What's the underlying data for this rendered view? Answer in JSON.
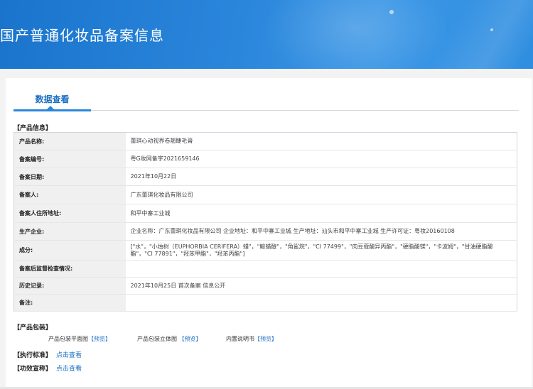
{
  "header": {
    "title": "国产普通化妆品备案信息"
  },
  "tabs": [
    {
      "label": "数据查看",
      "active": true
    }
  ],
  "product_info": {
    "section_title": "【产品信息】",
    "rows": [
      {
        "key": "产品名称:",
        "value": "蕾琪心动视界卷翘睫毛膏"
      },
      {
        "key": "备案编号:",
        "value": "粤G妆网备字2021659146"
      },
      {
        "key": "备案日期:",
        "value": "2021年10月22日"
      },
      {
        "key": "备案人:",
        "value": "广东蕾琪化妆品有限公司"
      },
      {
        "key": "备案人住所地址:",
        "value": "和平中寨工业城"
      },
      {
        "key": "生产企业:",
        "value": "企业名称：广东蕾琪化妆品有限公司 企业地址：和平中寨工业城 生产地址：汕头市和平中寨工业城 生产许可证：粤妆20160108"
      },
      {
        "key": "成分:",
        "value": "[\"水\"，\"小烛树（EUPHORBIA CERIFERA）蜡\"，\"鲸蜡醇\"，\"角鲨烷\"，\"CI 77499\"，\"肉豆蔻酸异丙酯\"，\"硬脂酸镁\"，\"卡波姆\"，\"甘油硬脂酸酯\"，\"CI 77891\"，\"羟苯甲酯\"，\"羟苯丙酯\"]"
      },
      {
        "key": "备案后监督检查情况:",
        "value": ""
      },
      {
        "key": "历史记录:",
        "value": "2021年10月25日 首次备案 信息公开"
      },
      {
        "key": "备注:",
        "value": ""
      }
    ]
  },
  "packaging": {
    "section_title": "【产品包装】",
    "items": [
      {
        "label": "产品包装平面图",
        "link": "【预览】"
      },
      {
        "label": "产品包装立体图",
        "link": "【预览】"
      },
      {
        "label": "内置说明书",
        "link": "【预览】"
      }
    ]
  },
  "standard": {
    "section_title": "【执行标准】",
    "link": "点击查看"
  },
  "efficacy": {
    "section_title": "【功效宣称】",
    "link": "点击查看"
  },
  "colors": {
    "banner": "#2a86db",
    "accent": "#1a6fc2",
    "key_bg": "#f0f0f0"
  }
}
